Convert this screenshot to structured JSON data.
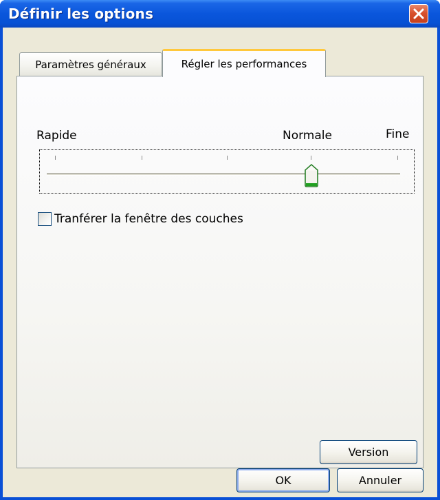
{
  "window": {
    "title": "Définir les options"
  },
  "tabs": [
    {
      "label": "Paramètres généraux",
      "active": false
    },
    {
      "label": "Régler les performances",
      "active": true
    }
  ],
  "performance": {
    "labels": {
      "left": "Rapide",
      "middle": "Normale",
      "right": "Fine"
    },
    "slider": {
      "tick_count": 5,
      "selected_index": 3,
      "thumb_color": "#21a121"
    },
    "checkbox": {
      "label": "Tranférer la fenêtre des couches",
      "checked": false
    },
    "version_button": "Version"
  },
  "footer": {
    "ok_label": "OK",
    "cancel_label": "Annuler"
  },
  "colors": {
    "titlebar": "#0a56dc",
    "dialog_face": "#ece9d8",
    "active_tab_accent": "#ffc83c",
    "close_button": "#d8512d"
  }
}
